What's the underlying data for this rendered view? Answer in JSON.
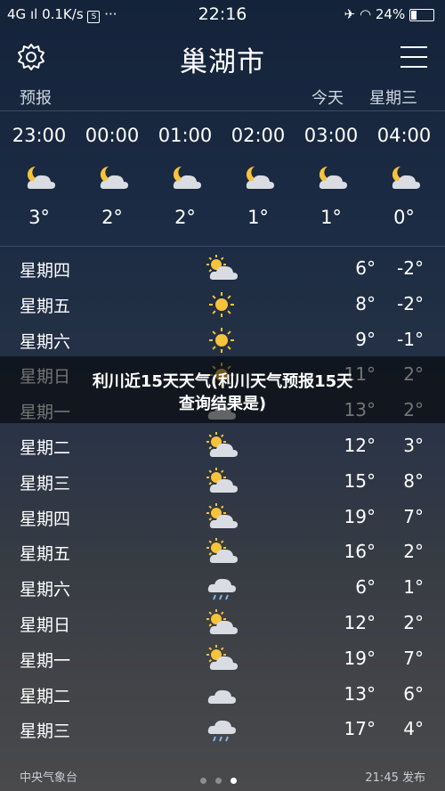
{
  "status_bar": {
    "network": "4G",
    "speed": "0.1K/s",
    "time": "22:16",
    "battery": "24%"
  },
  "header": {
    "city": "巢湖市",
    "forecast_label": "预报",
    "today_label": "今天",
    "weekday_label": "星期三"
  },
  "hourly": [
    {
      "time": "23:00",
      "icon": "moon-cloud-icon",
      "temp": "3°"
    },
    {
      "time": "00:00",
      "icon": "moon-cloud-icon",
      "temp": "2°"
    },
    {
      "time": "01:00",
      "icon": "moon-cloud-icon",
      "temp": "2°"
    },
    {
      "time": "02:00",
      "icon": "moon-cloud-icon",
      "temp": "1°"
    },
    {
      "time": "03:00",
      "icon": "moon-cloud-icon",
      "temp": "1°"
    },
    {
      "time": "04:00",
      "icon": "moon-cloud-icon",
      "temp": "0°"
    }
  ],
  "daily": [
    {
      "day": "星期四",
      "icon": "sun-cloud-icon",
      "high": "6°",
      "low": "-2°"
    },
    {
      "day": "星期五",
      "icon": "sun-icon",
      "high": "8°",
      "low": "-2°"
    },
    {
      "day": "星期六",
      "icon": "sun-icon",
      "high": "9°",
      "low": "-1°"
    },
    {
      "day": "星期日",
      "icon": "sun-icon",
      "high": "11°",
      "low": "2°"
    },
    {
      "day": "星期一",
      "icon": "cloud-icon",
      "high": "13°",
      "low": "2°"
    },
    {
      "day": "星期二",
      "icon": "sun-cloud-icon",
      "high": "12°",
      "low": "3°"
    },
    {
      "day": "星期三",
      "icon": "sun-cloud-icon",
      "high": "15°",
      "low": "8°"
    },
    {
      "day": "星期四",
      "icon": "sun-cloud-icon",
      "high": "19°",
      "low": "7°"
    },
    {
      "day": "星期五",
      "icon": "sun-cloud-icon",
      "high": "16°",
      "low": "2°"
    },
    {
      "day": "星期六",
      "icon": "rain-icon",
      "high": "6°",
      "low": "1°"
    },
    {
      "day": "星期日",
      "icon": "sun-cloud-icon",
      "high": "12°",
      "low": "2°"
    },
    {
      "day": "星期一",
      "icon": "sun-cloud-icon",
      "high": "19°",
      "low": "7°"
    },
    {
      "day": "星期二",
      "icon": "cloud-icon",
      "high": "13°",
      "low": "6°"
    },
    {
      "day": "星期三",
      "icon": "rain-icon",
      "high": "17°",
      "low": "4°"
    }
  ],
  "overlay": {
    "line1": "利川近15天天气(利川天气预报15天",
    "line2": "查询结果是)"
  },
  "footer": {
    "source": "中央气象台",
    "published": "21:45 发布"
  },
  "colors": {
    "sun": "#f6c33a",
    "cloud": "#d9dde3"
  }
}
